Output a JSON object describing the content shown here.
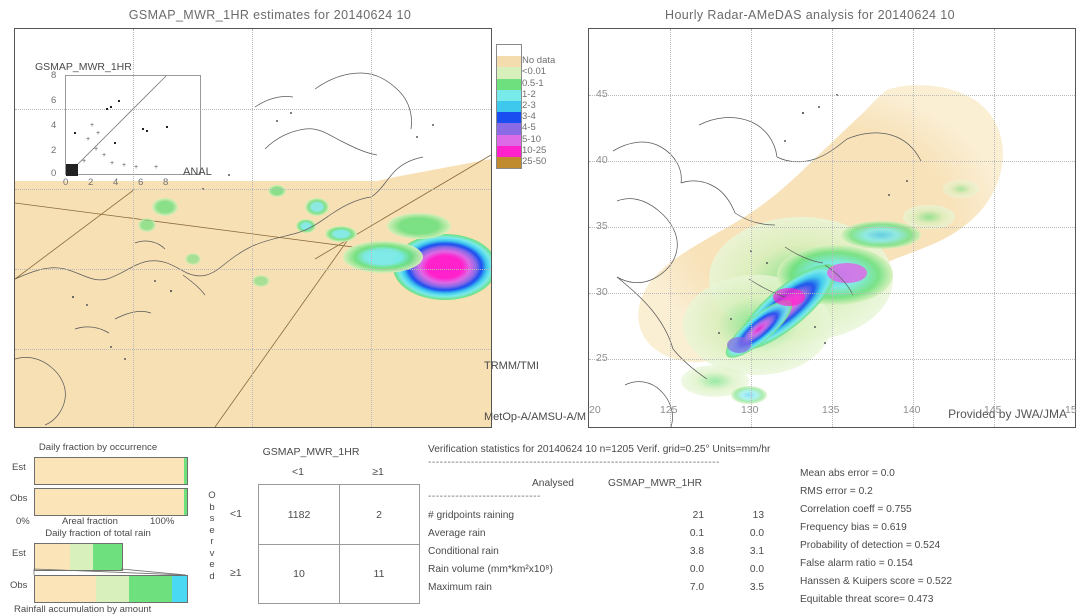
{
  "left_panel": {
    "title": "GSMAP_MWR_1HR estimates for 20140624 10",
    "inset_label": "GSMAP_MWR_1HR",
    "inset_y_ticks": [
      "8",
      "6",
      "4",
      "2",
      "0"
    ],
    "inset_x_ticks": [
      "0",
      "2",
      "4",
      "6",
      "8"
    ],
    "anal_label": "ANAL",
    "sensor_label_1": "TRMM/TMI",
    "sensor_label_2": "MetOp-A/AMSU-A/M"
  },
  "right_panel": {
    "title": "Hourly Radar-AMeDAS analysis for 20140624 10",
    "credit": "Provided by JWA/JMA",
    "x_ticks": [
      "120",
      "125",
      "130",
      "135",
      "140",
      "145",
      "15"
    ],
    "y_ticks": [
      "45",
      "40",
      "35",
      "30",
      "25",
      "20"
    ]
  },
  "colorbar": {
    "labels": [
      "No data",
      "<0.01",
      "0.5-1",
      "1-2",
      "2-3",
      "3-4",
      "4-5",
      "5-10",
      "10-25",
      "25-50"
    ],
    "colors": [
      "#ffffff",
      "#f5dcae",
      "#d8f0bc",
      "#6ee07e",
      "#79eaea",
      "#3fc8ee",
      "#1b4ef0",
      "#8b6ae6",
      "#dd6ae6",
      "#ff22cc",
      "#c08a2e"
    ]
  },
  "chart_data": [
    {
      "type": "bar",
      "title": "Daily fraction by occurrence",
      "xlabel": "Areal fraction",
      "categories": [
        "Est",
        "Obs"
      ],
      "axis_min_label": "0%",
      "axis_max_label": "100%",
      "series": [
        {
          "name": "Est",
          "segments": [
            {
              "label": "No data",
              "value": 98.3,
              "color": "#fbe4b8"
            },
            {
              "label": "rain",
              "value": 1.7,
              "color": "#6ee07e"
            }
          ]
        },
        {
          "name": "Obs",
          "segments": [
            {
              "label": "No data",
              "value": 98.3,
              "color": "#fbe4b8"
            },
            {
              "label": "rain",
              "value": 1.7,
              "color": "#6ee07e"
            }
          ]
        }
      ]
    },
    {
      "type": "bar",
      "title": "Daily fraction of total rain",
      "xlabel": "Rainfall accumulation by amount",
      "categories": [
        "Est",
        "Obs"
      ],
      "series": [
        {
          "name": "Est",
          "total": 57,
          "segments": [
            {
              "label": "<0.01",
              "value": 23,
              "color": "#fbe4b8"
            },
            {
              "label": "0.5-1",
              "value": 15,
              "color": "#d8f0bc"
            },
            {
              "label": "1-2",
              "value": 19,
              "color": "#6ee07e"
            }
          ]
        },
        {
          "name": "Obs",
          "total": 100,
          "segments": [
            {
              "label": "<0.01",
              "value": 40,
              "color": "#fbe4b8"
            },
            {
              "label": "0.5-1",
              "value": 22,
              "color": "#d8f0bc"
            },
            {
              "label": "1-2",
              "value": 28,
              "color": "#6ee07e"
            },
            {
              "label": "2-3",
              "value": 10,
              "color": "#49d9f2"
            }
          ]
        }
      ]
    },
    {
      "type": "table",
      "title": "GSMAP_MWR_1HR",
      "row_axis_label": "Observed",
      "col_headers": [
        "<1",
        "≥1"
      ],
      "row_headers": [
        "<1",
        "≥1"
      ],
      "values": [
        [
          1182,
          2
        ],
        [
          10,
          11
        ]
      ]
    }
  ],
  "stats": {
    "header": "Verification statistics for 20140624 10  n=1205  Verif. grid=0.25°  Units=mm/hr",
    "divider": "---------------------------------------------------------------------------",
    "col_analysed": "Analysed",
    "col_estimate": "GSMAP_MWR_1HR",
    "subdivider": "-----------------------------",
    "rows": [
      {
        "name": "# gridpoints raining",
        "analysed": "21",
        "estimate": "13"
      },
      {
        "name": "Average rain",
        "analysed": "0.1",
        "estimate": "0.0"
      },
      {
        "name": "Conditional rain",
        "analysed": "3.8",
        "estimate": "3.1"
      },
      {
        "name": "Rain volume (mm*km²x10⁸)",
        "analysed": "0.0",
        "estimate": "0.0"
      },
      {
        "name": "Maximum rain",
        "analysed": "7.0",
        "estimate": "3.5"
      }
    ],
    "metrics": [
      "Mean abs error = 0.0",
      "RMS error = 0.2",
      "Correlation coeff = 0.755",
      "Frequency bias = 0.619",
      "Probability of detection = 0.524",
      "False alarm ratio = 0.154",
      "Hanssen & Kuipers score = 0.522",
      "Equitable threat score= 0.473"
    ]
  }
}
